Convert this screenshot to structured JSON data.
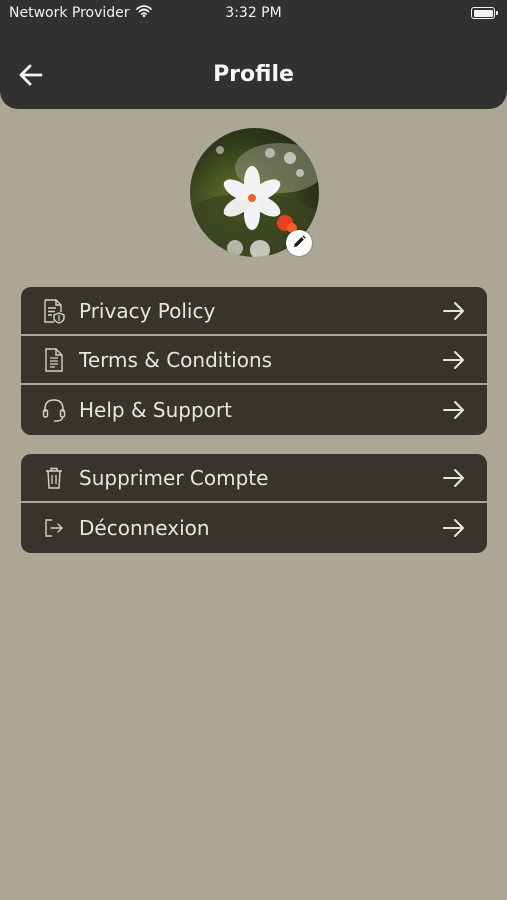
{
  "status_bar": {
    "carrier": "Network Provider",
    "time": "3:32 PM"
  },
  "header": {
    "title": "Profile",
    "back_icon": "back-arrow-icon"
  },
  "profile": {
    "avatar_icon": "flower-photo",
    "edit_icon": "pencil-icon"
  },
  "menu_groups": [
    {
      "items": [
        {
          "label": "Privacy Policy",
          "icon": "privacy-document-icon"
        },
        {
          "label": "Terms & Conditions",
          "icon": "document-lines-icon"
        },
        {
          "label": "Help & Support",
          "icon": "headset-icon"
        }
      ]
    },
    {
      "items": [
        {
          "label": "Supprimer Compte",
          "icon": "trash-icon"
        },
        {
          "label": "Déconnexion",
          "icon": "logout-icon"
        }
      ]
    }
  ],
  "colors": {
    "background": "#aca795",
    "header": "#313131",
    "menu_item": "#37342d",
    "text": "#e7e6e1"
  }
}
